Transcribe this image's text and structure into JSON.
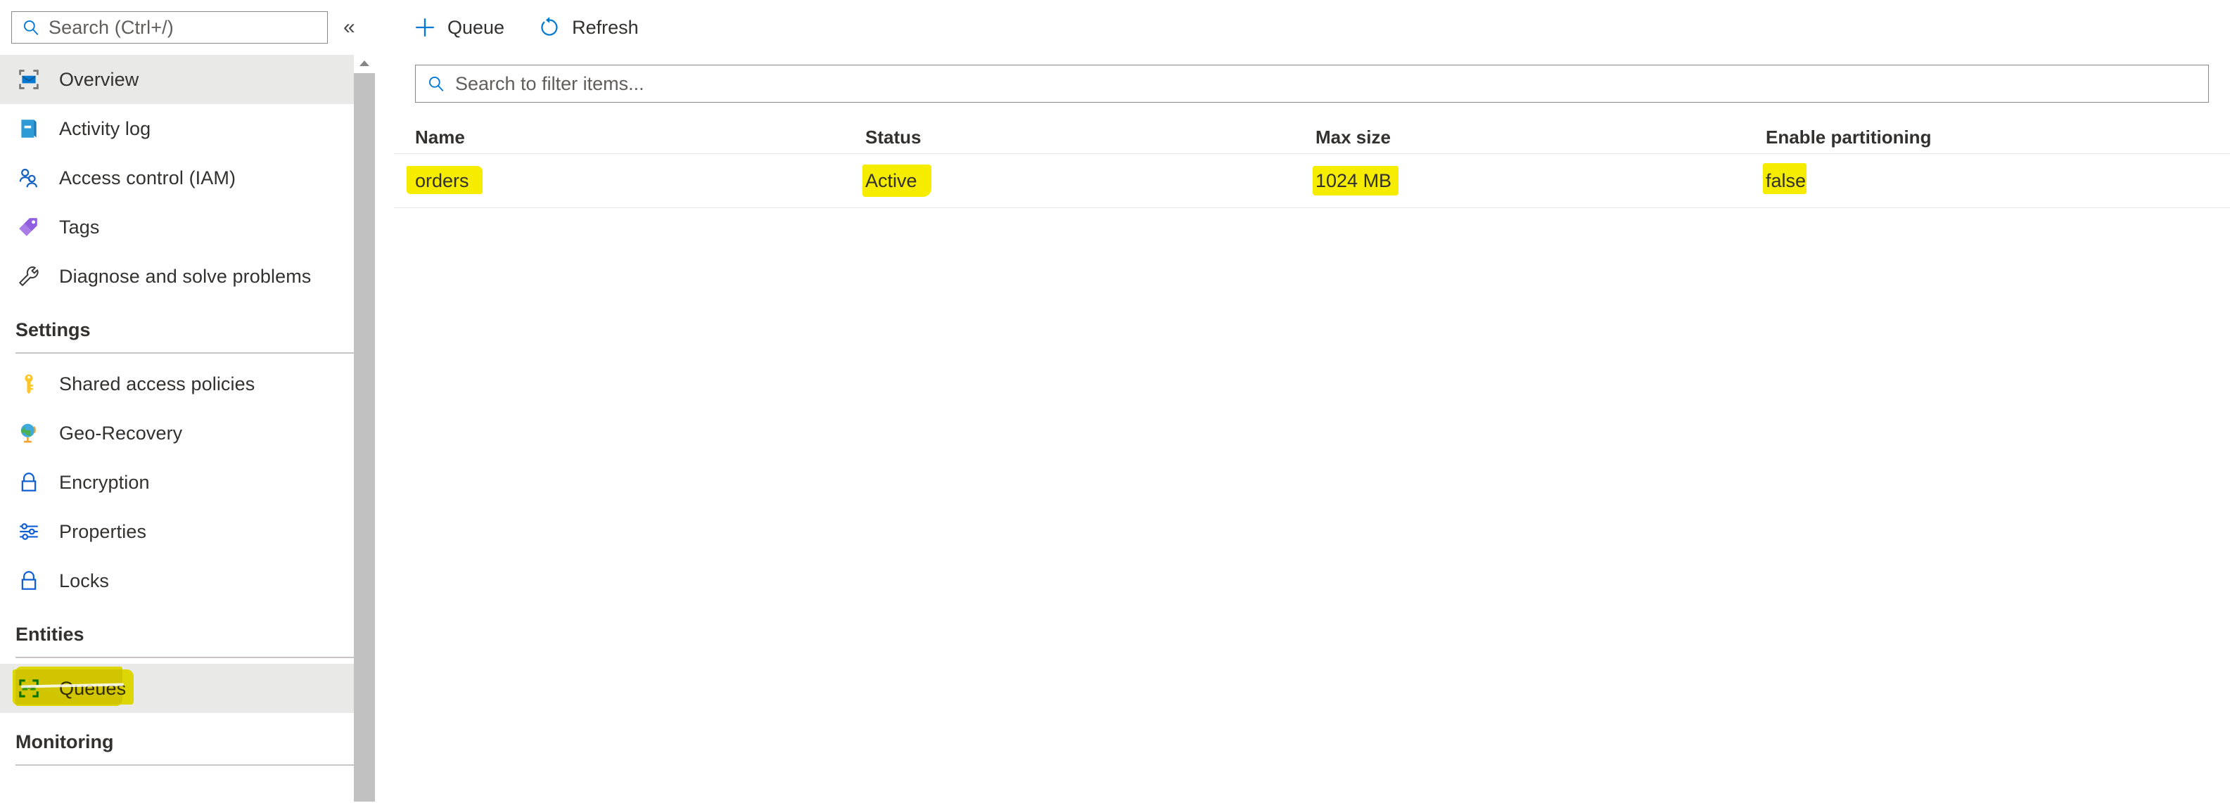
{
  "sidebar": {
    "search": {
      "placeholder": "Search (Ctrl+/)",
      "icon": "search-icon"
    },
    "collapse_label": "«",
    "items": [
      {
        "label": "Overview",
        "icon": "overview-icon",
        "selected": true
      },
      {
        "label": "Activity log",
        "icon": "activity-log-icon",
        "selected": false
      },
      {
        "label": "Access control (IAM)",
        "icon": "access-control-icon",
        "selected": false
      },
      {
        "label": "Tags",
        "icon": "tags-icon",
        "selected": false
      },
      {
        "label": "Diagnose and solve problems",
        "icon": "wrench-icon",
        "selected": false
      }
    ],
    "groups": [
      {
        "title": "Settings",
        "items": [
          {
            "label": "Shared access policies",
            "icon": "key-icon",
            "selected": false
          },
          {
            "label": "Geo-Recovery",
            "icon": "globe-icon",
            "selected": false
          },
          {
            "label": "Encryption",
            "icon": "lock-icon",
            "selected": false
          },
          {
            "label": "Properties",
            "icon": "sliders-icon",
            "selected": false
          },
          {
            "label": "Locks",
            "icon": "lock-icon",
            "selected": false
          }
        ]
      },
      {
        "title": "Entities",
        "items": [
          {
            "label": "Queues",
            "icon": "queues-icon",
            "selected": true,
            "highlighted": true
          }
        ]
      },
      {
        "title": "Monitoring",
        "items": []
      }
    ],
    "scrollbar": {
      "up_arrow": "scroll-up-arrow"
    }
  },
  "toolbar": {
    "buttons": [
      {
        "label": "Queue",
        "icon": "plus-icon"
      },
      {
        "label": "Refresh",
        "icon": "refresh-icon"
      }
    ]
  },
  "filter": {
    "placeholder": "Search to filter items...",
    "value": "",
    "icon": "search-icon"
  },
  "table": {
    "columns": [
      "Name",
      "Status",
      "Max size",
      "Enable partitioning"
    ],
    "rows": [
      {
        "name": "orders",
        "status": "Active",
        "max_size": "1024 MB",
        "enable_partitioning": "false"
      }
    ]
  },
  "colors": {
    "accent": "#0078d4",
    "highlight": "#f5ec00",
    "selected_row": "#e9e9e8",
    "text": "#323130"
  }
}
